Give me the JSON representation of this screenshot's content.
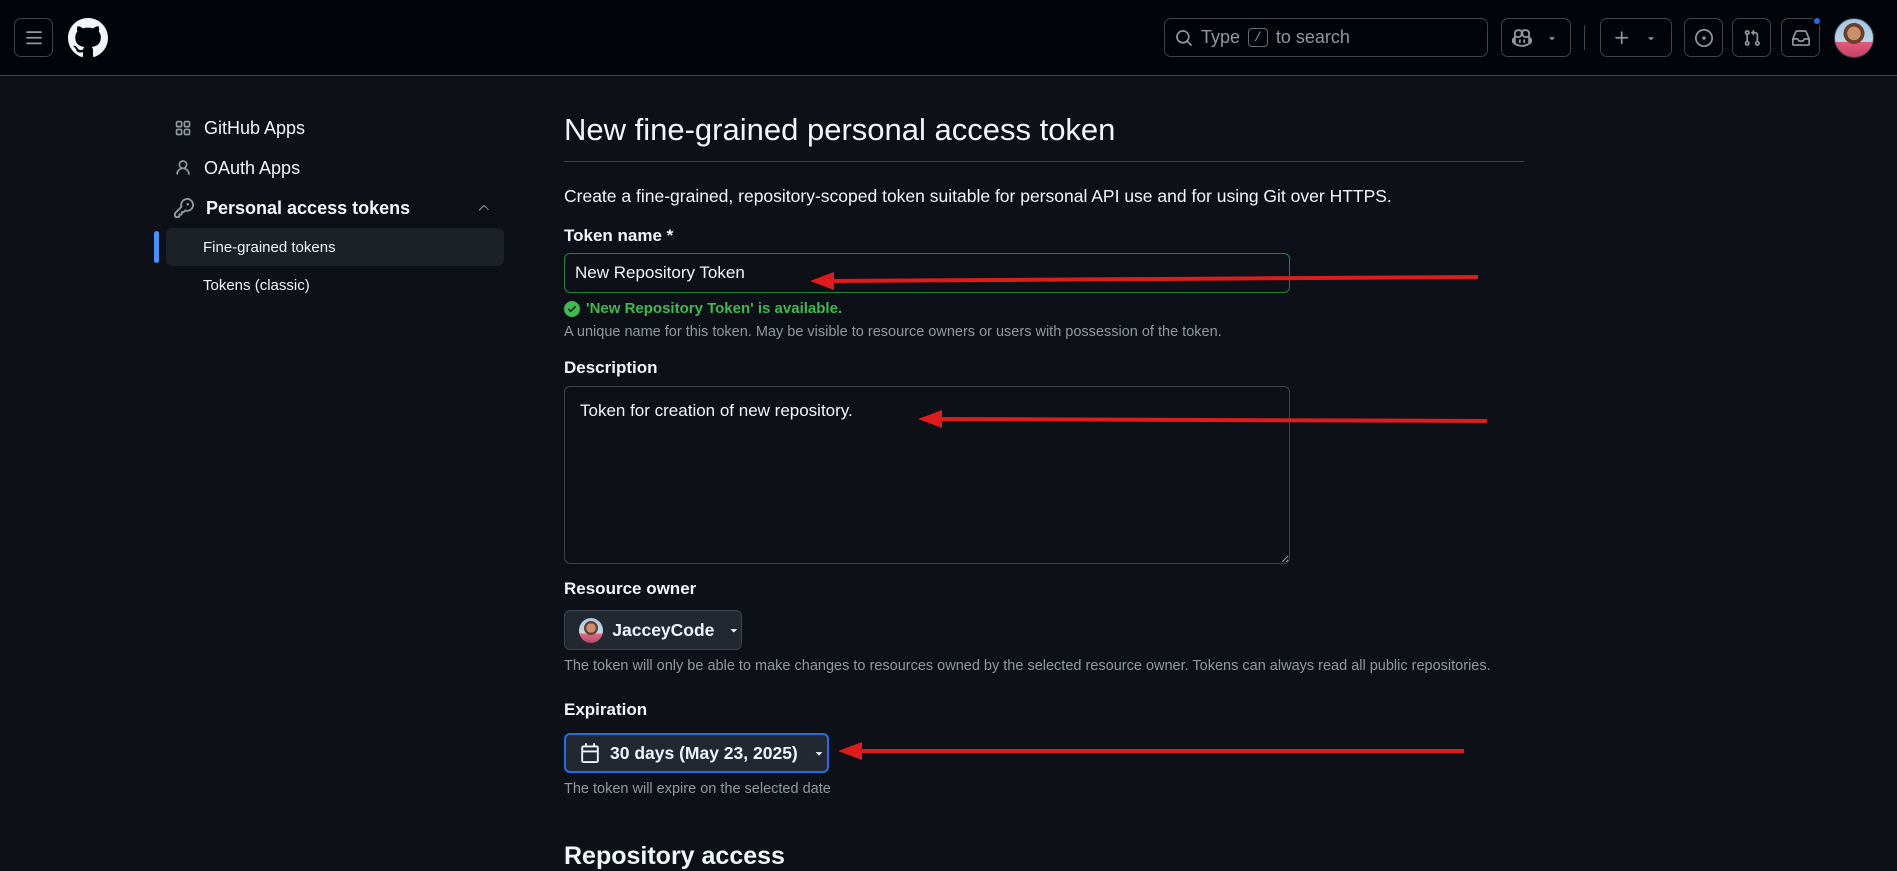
{
  "header": {
    "menu_icon": "hamburger-icon",
    "logo_icon": "github-logo-icon",
    "search": {
      "placeholder_prefix": "Type",
      "shortcut": "/",
      "placeholder_suffix": "to search"
    },
    "copilot_icon": "copilot-icon",
    "create_icon": "plus-icon",
    "issues_icon": "issue-opened-icon",
    "pulls_icon": "git-pull-request-icon",
    "inbox_icon": "inbox-icon",
    "notification_color": "#1f6feb"
  },
  "sidebar": {
    "items": [
      {
        "label": "GitHub Apps",
        "icon": "apps-icon"
      },
      {
        "label": "OAuth Apps",
        "icon": "person-icon"
      },
      {
        "label": "Personal access tokens",
        "icon": "key-icon"
      }
    ],
    "sub_items": [
      {
        "label": "Fine-grained tokens",
        "active": true
      },
      {
        "label": "Tokens (classic)",
        "active": false
      }
    ]
  },
  "main": {
    "title": "New fine-grained personal access token",
    "intro": "Create a fine-grained, repository-scoped token suitable for personal API use and for using Git over HTTPS.",
    "token_name": {
      "label": "Token name *",
      "value": "New Repository Token",
      "success": "'New Repository Token' is available.",
      "hint": "A unique name for this token. May be visible to resource owners or users with possession of the token."
    },
    "description": {
      "label": "Description",
      "value": "Token for creation of new repository."
    },
    "resource_owner": {
      "label": "Resource owner",
      "value": "JacceyCode",
      "hint": "The token will only be able to make changes to resources owned by the selected resource owner. Tokens can always read all public repositories."
    },
    "expiration": {
      "label": "Expiration",
      "value": "30 days (May 23, 2025)",
      "hint": "The token will expire on the selected date"
    },
    "next_section": "Repository access"
  },
  "annotation_color": "#e01b1b"
}
